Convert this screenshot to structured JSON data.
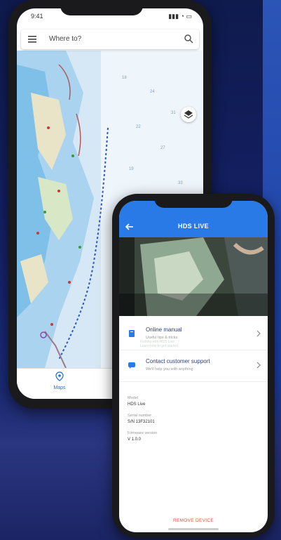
{
  "map_app": {
    "status_time": "9:41",
    "status_icons": "▮▮▮ ◔ ▭",
    "search_placeholder": "Where to?",
    "nav_maps_label": "Maps",
    "icons": [
      "menu-icon",
      "search-icon",
      "layers-icon",
      "map-pin-icon"
    ]
  },
  "hds_app": {
    "title": "HDS LIVE",
    "video_caption_line1": "Fishing with HDS Live",
    "video_caption_line2": "Learn how to get started",
    "items": [
      {
        "title": "Online manual",
        "subtitle": "Useful tips & tricks",
        "icon": "book-icon"
      },
      {
        "title": "Contact customer support",
        "subtitle": "We'll help you with anything",
        "icon": "chat-icon"
      }
    ],
    "device": {
      "model_label": "Model",
      "model_value": "HDS Live",
      "serial_label": "Serial number",
      "serial_value": "S/N 13F32101",
      "firmware_label": "Firmware version",
      "firmware_value": "V 1.0.0"
    },
    "remove_label": "REMOVE DEVICE"
  },
  "colors": {
    "background": "#142063",
    "appbar": "#2979e6",
    "accent_red": "#e0533c",
    "map_water": "#d6e8f5"
  }
}
